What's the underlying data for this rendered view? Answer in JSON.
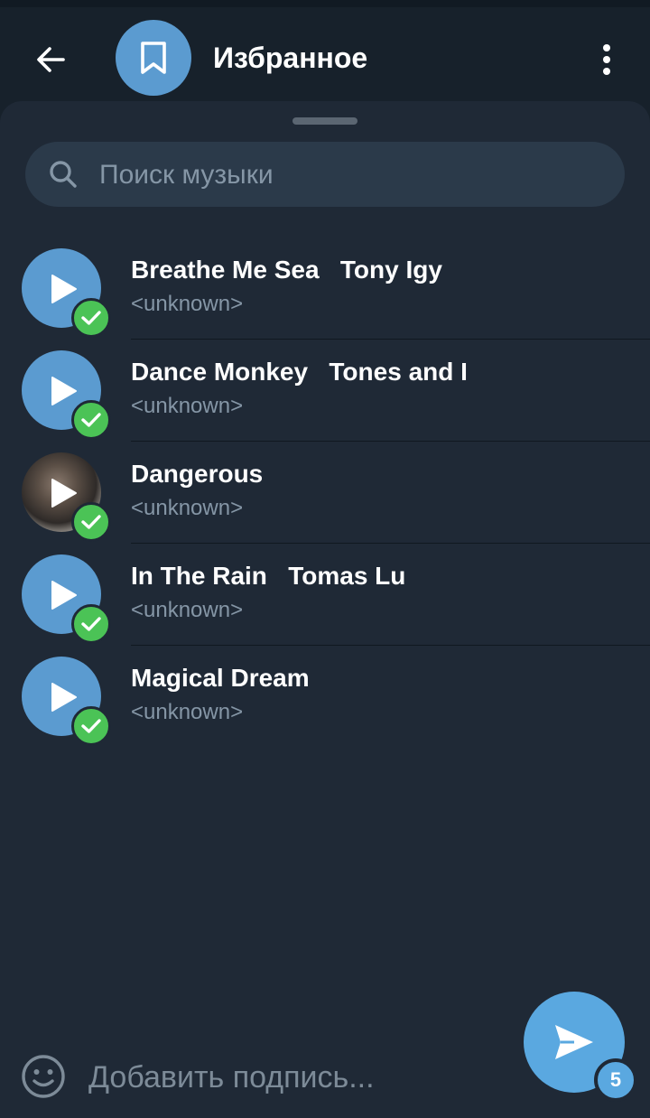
{
  "header": {
    "title": "Избранное",
    "back_icon": "arrow-left-icon",
    "avatar_icon": "bookmark-icon",
    "menu_icon": "more-vertical-icon"
  },
  "search": {
    "placeholder": "Поиск музыки",
    "value": ""
  },
  "tracks": [
    {
      "title": "Breathe Me Sea   Tony Igy",
      "subtitle": "<unknown>",
      "selected": true,
      "cover": "default"
    },
    {
      "title": "Dance Monkey   Tones and I",
      "subtitle": "<unknown>",
      "selected": true,
      "cover": "default"
    },
    {
      "title": "Dangerous",
      "subtitle": "<unknown>",
      "selected": true,
      "cover": "photo"
    },
    {
      "title": "In The Rain   Tomas Lu",
      "subtitle": "<unknown>",
      "selected": true,
      "cover": "default"
    },
    {
      "title": "Magical Dream",
      "subtitle": "<unknown>",
      "selected": true,
      "cover": "default"
    }
  ],
  "caption": {
    "placeholder": "Добавить подпись...",
    "value": ""
  },
  "send": {
    "count": "5",
    "icon": "send-icon"
  },
  "colors": {
    "background": "#17212b",
    "sheet": "#1f2936",
    "accent": "#5aa8e0",
    "check": "#4bc356",
    "muted_text": "#8596a6"
  }
}
